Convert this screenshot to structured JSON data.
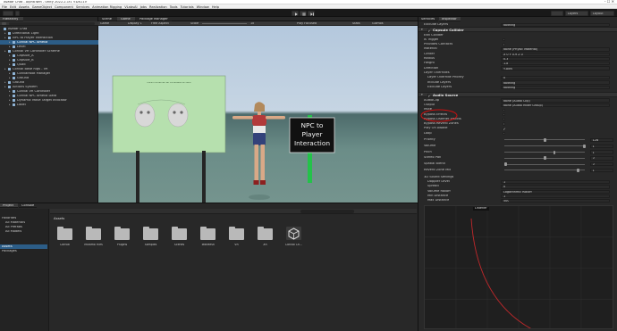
{
  "window": {
    "title": "Avatar Chat - AlphaTwin - Unity 2022.2.1f1 <DX11>"
  },
  "menu": [
    "File",
    "Edit",
    "Assets",
    "GameObject",
    "Component",
    "Services",
    "Animation Rigging",
    "VLabsAI",
    "Jobs",
    "Realization",
    "Tools",
    "Tutorials",
    "Window",
    "Help"
  ],
  "toolbar": {
    "right_tabs": [
      "Layers",
      "Layout"
    ]
  },
  "hierarchy": {
    "tab": "Hierarchy",
    "rows": [
      {
        "label": "Avatar Chat",
        "indent": 0,
        "selected": false
      },
      {
        "label": "Directional Light",
        "indent": 1,
        "selected": false
      },
      {
        "label": "NPC to Player Interaction",
        "indent": 1,
        "selected": false
      },
      {
        "label": "Convai NPC Amelia",
        "indent": 2,
        "selected": true
      },
      {
        "label": "Level",
        "indent": 2,
        "selected": false
      },
      {
        "label": "Convai VR Controller Scheme",
        "indent": 1,
        "selected": false
      },
      {
        "label": "Capsule_A",
        "indent": 2,
        "selected": false
      },
      {
        "label": "Capsule_B",
        "indent": 2,
        "selected": false
      },
      {
        "label": "Quad",
        "indent": 2,
        "selected": false
      },
      {
        "label": "Convai Base Rigs - VR",
        "indent": 1,
        "selected": false
      },
      {
        "label": "ConvaiRoot Manager",
        "indent": 2,
        "selected": false
      },
      {
        "label": "Ground",
        "indent": 2,
        "selected": false
      },
      {
        "label": "Ground",
        "indent": 1,
        "selected": false
      },
      {
        "label": "Actions System",
        "indent": 1,
        "selected": false
      },
      {
        "label": "Convai VR Controller",
        "indent": 2,
        "selected": false
      },
      {
        "label": "Convai NPC Amelia Data",
        "indent": 2,
        "selected": false
      },
      {
        "label": "Dynamic Move Target Indicator",
        "indent": 2,
        "selected": false
      },
      {
        "label": "Label",
        "indent": 2,
        "selected": false
      }
    ]
  },
  "scene": {
    "tabs": [
      "Scene",
      "Game",
      "Package Manager"
    ],
    "controls": [
      "Game",
      "Display 1",
      "Free Aspect",
      "Scale",
      "1x",
      "Play Focused",
      "Stats",
      "Gizmos"
    ],
    "billboard_title": "Lorem Amanda Vel Consulate Archers",
    "sign_text": "NPC to\nPlayer\nInteraction"
  },
  "project": {
    "tabs": [
      "Project",
      "Console"
    ],
    "left_items": [
      "Favorites",
      "All Materials",
      "All Prefabs",
      "All Models",
      "Assets",
      "Packages"
    ],
    "breadcrumb": "Assets",
    "folders": [
      "Convai",
      "Mixamo Files",
      "Plugins",
      "Samples",
      "Scenes",
      "TextMesh",
      "VR",
      "XR",
      "Convai Ch..."
    ]
  },
  "inspector": {
    "tabs": [
      "Inspector",
      "Services"
    ],
    "top_rows": [
      {
        "label": "Exclude Layers",
        "value": "Nothing"
      },
      {
        "label": "Capsule Collider",
        "value": ""
      }
    ],
    "capsule": [
      {
        "label": "Edit Collider",
        "value": ""
      },
      {
        "label": "Is Trigger",
        "value": ""
      },
      {
        "label": "Provides Contacts",
        "value": ""
      },
      {
        "label": "Material",
        "value": "None (Physic Material)"
      },
      {
        "label": "Center",
        "value": "X 0  Y 0.9  Z 0"
      },
      {
        "label": "Radius",
        "value": "0.3"
      },
      {
        "label": "Height",
        "value": "1.8"
      },
      {
        "label": "Direction",
        "value": "Y-Axis"
      },
      {
        "label": "Layer Overrides",
        "value": ""
      },
      {
        "label": "Layer Override Priority",
        "value": "0"
      },
      {
        "label": "Include Layers",
        "value": "Nothing"
      },
      {
        "label": "Exclude Layers",
        "value": "Nothing"
      }
    ],
    "audio_source_title": "Audio Source",
    "audio": [
      {
        "label": "AudioClip",
        "value": "None (Audio Clip)"
      },
      {
        "label": "Output",
        "value": "None (Audio Mixer Group)"
      },
      {
        "label": "Mute",
        "value": ""
      },
      {
        "label": "Bypass Effects",
        "value": ""
      },
      {
        "label": "Bypass Listener Effects",
        "value": ""
      },
      {
        "label": "Bypass Reverb Zones",
        "value": ""
      },
      {
        "label": "Play On Awake",
        "value": ""
      },
      {
        "label": "Loop",
        "value": ""
      }
    ],
    "sliders": [
      {
        "label": "Priority",
        "value": "128",
        "level": 0.5
      },
      {
        "label": "Volume",
        "value": "1",
        "level": 1.0
      },
      {
        "label": "Pitch",
        "value": "1",
        "level": 0.62
      },
      {
        "label": "Stereo Pan",
        "value": "0",
        "level": 0.5
      },
      {
        "label": "Spatial Blend",
        "value": "0",
        "level": 0.0
      },
      {
        "label": "Reverb Zone Mix",
        "value": "1",
        "level": 0.92
      }
    ],
    "sound3d": [
      {
        "label": "3D Sound Settings",
        "value": ""
      },
      {
        "label": "Doppler Level",
        "value": "1"
      },
      {
        "label": "Spread",
        "value": "0"
      },
      {
        "label": "Volume Rolloff",
        "value": "Logarithmic Rolloff"
      },
      {
        "label": "Min Distance",
        "value": "1"
      },
      {
        "label": "Max Distance",
        "value": "500"
      }
    ],
    "graph_label": "Listener"
  },
  "colors": {
    "selection": "#2c5d87",
    "annotation_circle": "#d01010"
  }
}
